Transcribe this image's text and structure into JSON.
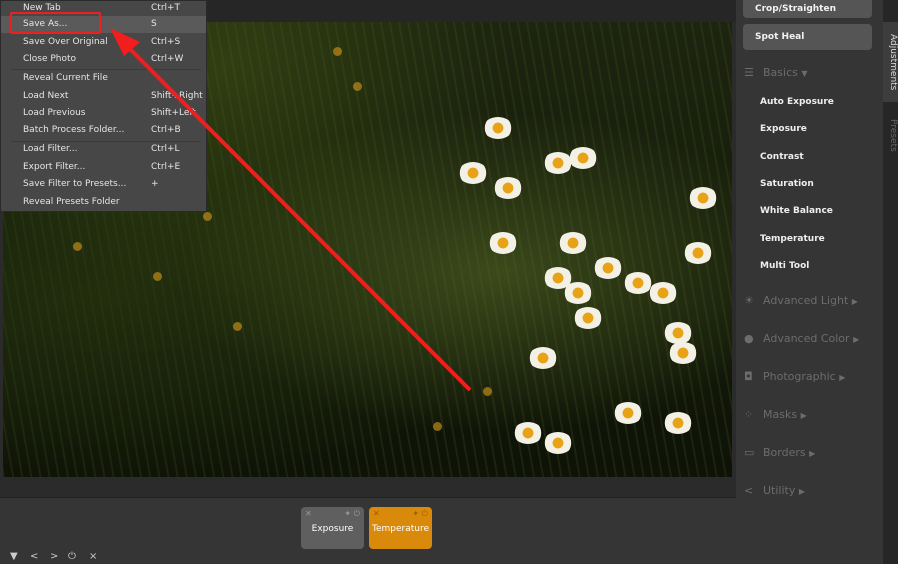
{
  "menu": {
    "items": [
      {
        "label": "New Tab",
        "shortcut": "Ctrl+T"
      },
      {
        "label": "Save As...",
        "shortcut": "S"
      },
      {
        "label": "Save Over Original",
        "shortcut": "Ctrl+S"
      },
      {
        "label": "Close Photo",
        "shortcut": "Ctrl+W"
      },
      {
        "label": "Reveal Current File",
        "shortcut": ""
      },
      {
        "label": "Load Next",
        "shortcut": "Shift+Right"
      },
      {
        "label": "Load Previous",
        "shortcut": "Shift+Left"
      },
      {
        "label": "Batch Process Folder...",
        "shortcut": "Ctrl+B"
      },
      {
        "label": "Load Filter...",
        "shortcut": "Ctrl+L"
      },
      {
        "label": "Export Filter...",
        "shortcut": "Ctrl+E"
      },
      {
        "label": "Save Filter to Presets...",
        "shortcut": "+"
      },
      {
        "label": "Reveal Presets Folder",
        "shortcut": ""
      }
    ]
  },
  "filters": {
    "chips": [
      {
        "label": "Exposure",
        "color": "#5f5f5f"
      },
      {
        "label": "Temperature",
        "color": "#d98a0b"
      }
    ]
  },
  "bottom_icons": {
    "collapse": "▼",
    "prev": "<",
    "next": ">",
    "reset": "⏻",
    "close": "×"
  },
  "panel": {
    "tools": [
      "Crop/Straighten",
      "Spot Heal"
    ],
    "basics": {
      "label": "Basics",
      "items": [
        "Auto Exposure",
        "Exposure",
        "Contrast",
        "Saturation",
        "White Balance",
        "Temperature",
        "Multi Tool"
      ]
    },
    "sections": [
      "Advanced Light",
      "Advanced Color",
      "Photographic",
      "Masks",
      "Borders",
      "Utility"
    ]
  },
  "side_tabs": [
    "Adjustments",
    "Presets"
  ],
  "annotation_color": "#f21d1d"
}
